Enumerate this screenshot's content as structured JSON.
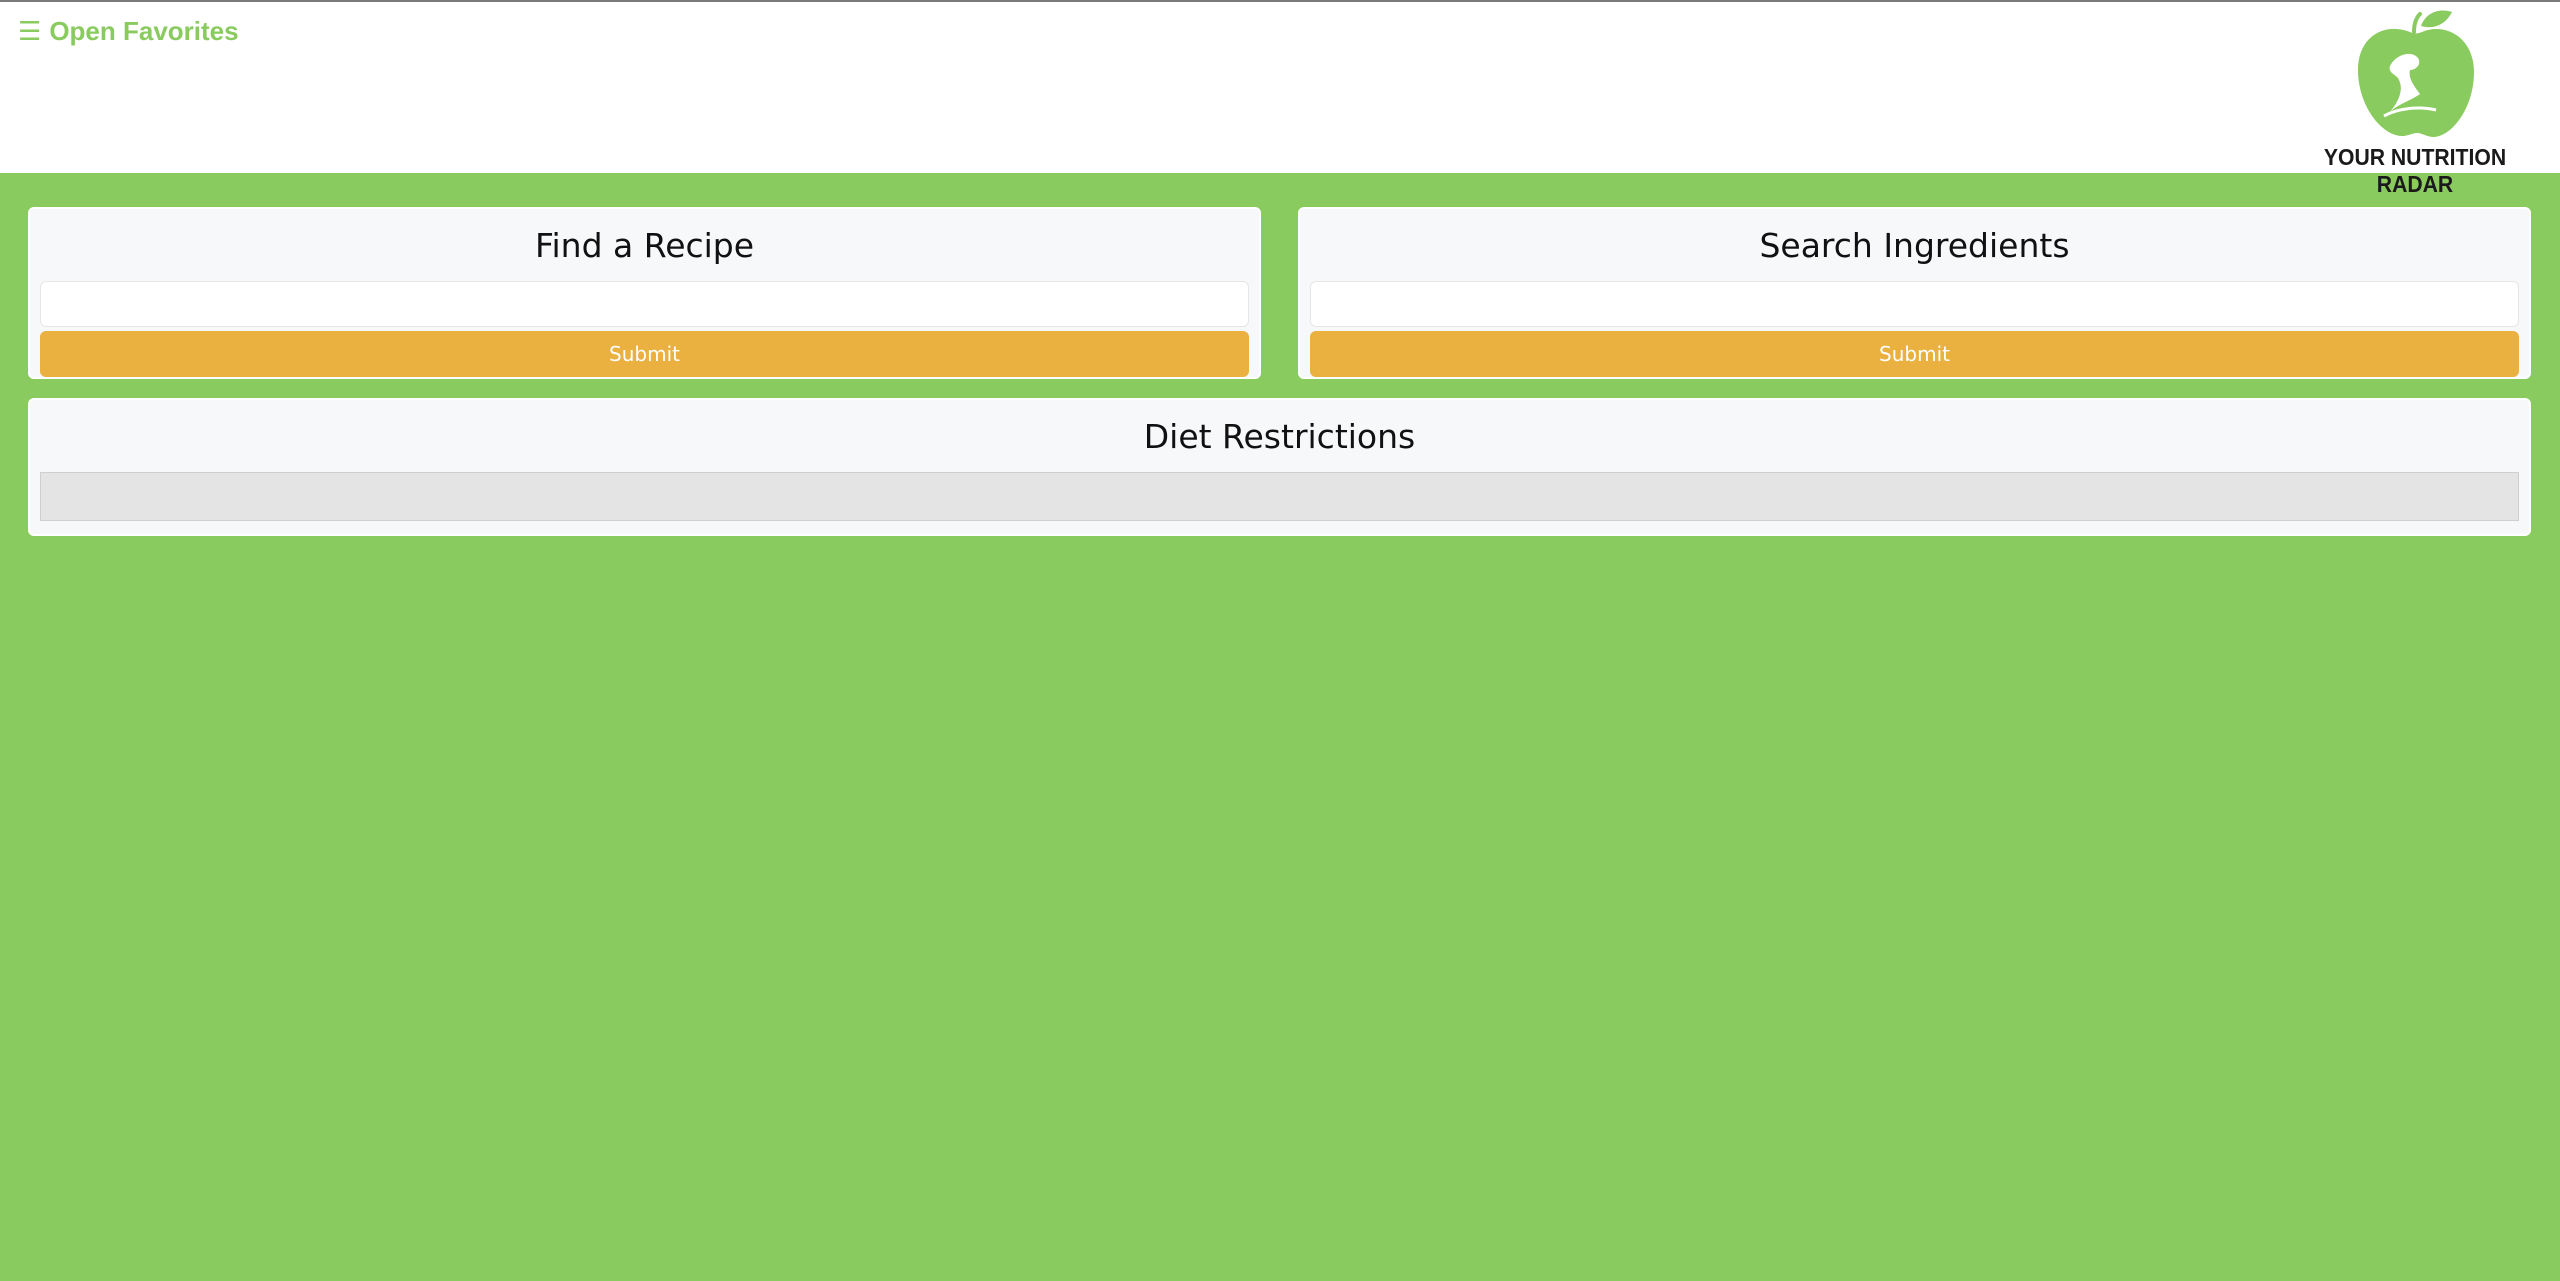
{
  "header": {
    "favorites_icon": "☰",
    "favorites_label": "Open Favorites",
    "logo_text": "YOUR NUTRITION RADAR",
    "logo_icon": "apple-bicep-icon"
  },
  "colors": {
    "background_green": "#89cb5f",
    "button_orange": "#eab040",
    "card_background": "#f7f8fa"
  },
  "recipe_card": {
    "title": "Find a Recipe",
    "input_value": "",
    "submit_label": "Submit"
  },
  "ingredients_card": {
    "title": "Search Ingredients",
    "input_value": "",
    "submit_label": "Submit"
  },
  "diet_card": {
    "title": "Diet Restrictions"
  }
}
